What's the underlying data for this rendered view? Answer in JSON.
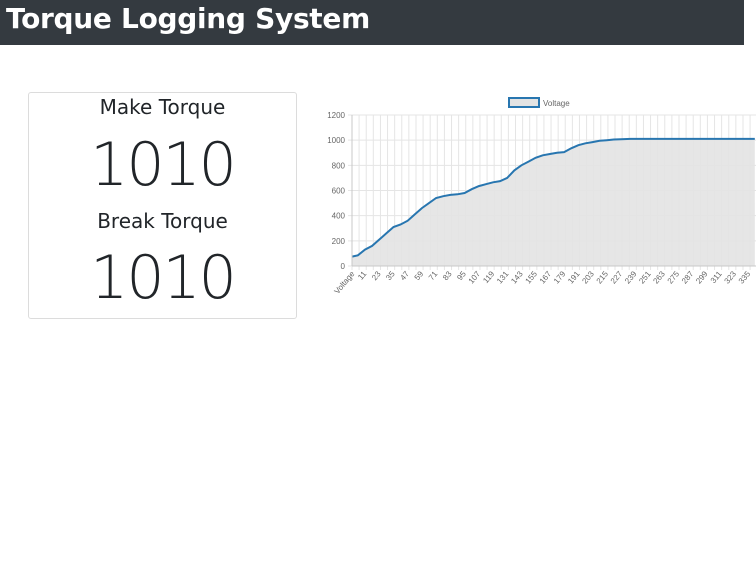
{
  "header": {
    "title": "Torque Logging System"
  },
  "torque": {
    "make_label": "Make Torque",
    "make_value": "1010",
    "break_label": "Break Torque",
    "break_value": "1010"
  },
  "chart_data": {
    "type": "area",
    "legend": [
      "Voltage"
    ],
    "legend_position": "top",
    "grid": true,
    "ylim": [
      0,
      1200
    ],
    "y_ticks": [
      0,
      200,
      400,
      600,
      800,
      1000,
      1200
    ],
    "x_ticks": [
      "Voltage",
      "11",
      "23",
      "35",
      "47",
      "59",
      "71",
      "83",
      "95",
      "107",
      "119",
      "131",
      "143",
      "155",
      "167",
      "179",
      "191",
      "203",
      "215",
      "227",
      "239",
      "251",
      "263",
      "275",
      "287",
      "299",
      "311",
      "323",
      "335"
    ],
    "series": [
      {
        "name": "Voltage",
        "color": "#2876b0",
        "fill": "#e3e3e3",
        "x": [
          0,
          5,
          11,
          17,
          23,
          29,
          35,
          41,
          47,
          53,
          59,
          65,
          71,
          77,
          83,
          89,
          95,
          101,
          107,
          113,
          119,
          125,
          131,
          137,
          143,
          149,
          155,
          161,
          167,
          173,
          179,
          185,
          191,
          197,
          203,
          209,
          215,
          221,
          227,
          235,
          250,
          275,
          300,
          320,
          335,
          340
        ],
        "y": [
          75,
          85,
          130,
          160,
          210,
          260,
          310,
          330,
          360,
          410,
          460,
          500,
          540,
          555,
          565,
          570,
          580,
          610,
          635,
          650,
          665,
          675,
          700,
          760,
          800,
          830,
          860,
          880,
          890,
          900,
          905,
          935,
          960,
          975,
          985,
          995,
          1000,
          1005,
          1008,
          1010,
          1010,
          1010,
          1010,
          1010,
          1010,
          1010
        ]
      }
    ]
  }
}
